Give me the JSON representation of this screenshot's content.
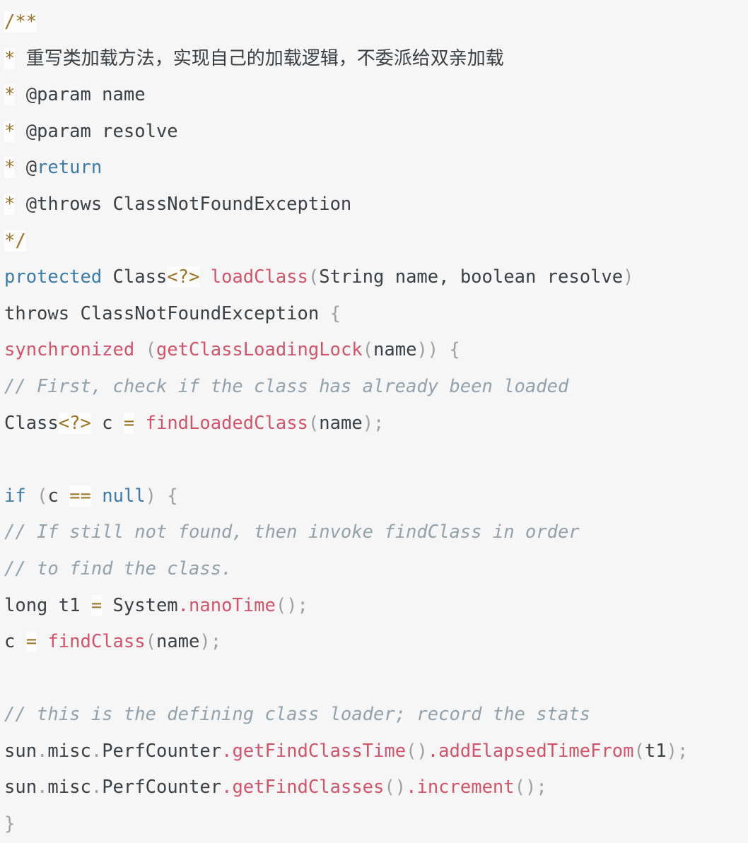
{
  "editor": {
    "language": "java",
    "background_color": "#f6f6f6",
    "token_colors": {
      "plain": "#3b4045",
      "keyword": "#3a7ca8",
      "function": "#d2546b",
      "operator": "#9b7526",
      "punctuation": "#9aa0a6",
      "comment": "#93a1ab"
    }
  },
  "code": {
    "lines": [
      {
        "n": 1,
        "tokens": [
          {
            "t": "op",
            "v": "/**"
          }
        ]
      },
      {
        "n": 2,
        "tokens": [
          {
            "t": "cjk-star",
            "v": "*"
          },
          {
            "t": "plain",
            "v": " "
          },
          {
            "t": "cjk",
            "v": "重写类加载方法，实现自己的加载逻辑，不委派给双亲加载"
          }
        ]
      },
      {
        "n": 3,
        "tokens": [
          {
            "t": "cjk-star",
            "v": "*"
          },
          {
            "t": "plain",
            "v": " @param name"
          }
        ]
      },
      {
        "n": 4,
        "tokens": [
          {
            "t": "cjk-star",
            "v": "*"
          },
          {
            "t": "plain",
            "v": " @param resolve"
          }
        ]
      },
      {
        "n": 5,
        "tokens": [
          {
            "t": "cjk-star",
            "v": "*"
          },
          {
            "t": "plain",
            "v": " @"
          },
          {
            "t": "keyword",
            "v": "return"
          }
        ]
      },
      {
        "n": 6,
        "tokens": [
          {
            "t": "cjk-star",
            "v": "*"
          },
          {
            "t": "plain",
            "v": " @throws ClassNotFoundException"
          }
        ]
      },
      {
        "n": 7,
        "tokens": [
          {
            "t": "op",
            "v": "*/"
          }
        ]
      },
      {
        "n": 8,
        "tokens": [
          {
            "t": "keyword",
            "v": "protected"
          },
          {
            "t": "plain",
            "v": " Class"
          },
          {
            "t": "op",
            "v": "<?>"
          },
          {
            "t": "plain",
            "v": " "
          },
          {
            "t": "func",
            "v": "loadClass"
          },
          {
            "t": "punct",
            "v": "("
          },
          {
            "t": "plain",
            "v": "String name, boolean resolve"
          },
          {
            "t": "punct",
            "v": ")"
          }
        ]
      },
      {
        "n": 9,
        "tokens": [
          {
            "t": "plain",
            "v": "throws ClassNotFoundException "
          },
          {
            "t": "punct",
            "v": "{"
          }
        ]
      },
      {
        "n": 10,
        "tokens": [
          {
            "t": "func",
            "v": "synchronized"
          },
          {
            "t": "plain",
            "v": " "
          },
          {
            "t": "punct",
            "v": "("
          },
          {
            "t": "func",
            "v": "getClassLoadingLock"
          },
          {
            "t": "punct",
            "v": "("
          },
          {
            "t": "plain",
            "v": "name"
          },
          {
            "t": "punct",
            "v": "))"
          },
          {
            "t": "plain",
            "v": " "
          },
          {
            "t": "punct",
            "v": "{"
          }
        ]
      },
      {
        "n": 11,
        "tokens": [
          {
            "t": "comment",
            "v": "// First, check if the class has already been loaded"
          }
        ]
      },
      {
        "n": 12,
        "tokens": [
          {
            "t": "plain",
            "v": "Class"
          },
          {
            "t": "op",
            "v": "<?>"
          },
          {
            "t": "plain",
            "v": " c "
          },
          {
            "t": "op",
            "v": "="
          },
          {
            "t": "plain",
            "v": " "
          },
          {
            "t": "func",
            "v": "findLoadedClass"
          },
          {
            "t": "punct",
            "v": "("
          },
          {
            "t": "plain",
            "v": "name"
          },
          {
            "t": "punct",
            "v": ");"
          }
        ]
      },
      {
        "n": 13,
        "tokens": []
      },
      {
        "n": 14,
        "tokens": [
          {
            "t": "keyword",
            "v": "if"
          },
          {
            "t": "plain",
            "v": " "
          },
          {
            "t": "punct",
            "v": "("
          },
          {
            "t": "plain",
            "v": "c "
          },
          {
            "t": "op",
            "v": "=="
          },
          {
            "t": "plain",
            "v": " "
          },
          {
            "t": "keyword",
            "v": "null"
          },
          {
            "t": "punct",
            "v": ")"
          },
          {
            "t": "plain",
            "v": " "
          },
          {
            "t": "punct",
            "v": "{"
          }
        ]
      },
      {
        "n": 15,
        "tokens": [
          {
            "t": "comment",
            "v": "// If still not found, then invoke findClass in order"
          }
        ]
      },
      {
        "n": 16,
        "tokens": [
          {
            "t": "comment",
            "v": "// to find the class."
          }
        ]
      },
      {
        "n": 17,
        "tokens": [
          {
            "t": "plain",
            "v": "long t1 "
          },
          {
            "t": "op",
            "v": "="
          },
          {
            "t": "plain",
            "v": " System"
          },
          {
            "t": "func",
            "v": ".nanoTime"
          },
          {
            "t": "punct",
            "v": "();"
          }
        ]
      },
      {
        "n": 18,
        "tokens": [
          {
            "t": "plain",
            "v": "c "
          },
          {
            "t": "op",
            "v": "="
          },
          {
            "t": "plain",
            "v": " "
          },
          {
            "t": "func",
            "v": "findClass"
          },
          {
            "t": "punct",
            "v": "("
          },
          {
            "t": "plain",
            "v": "name"
          },
          {
            "t": "punct",
            "v": ");"
          }
        ]
      },
      {
        "n": 19,
        "tokens": []
      },
      {
        "n": 20,
        "tokens": [
          {
            "t": "comment",
            "v": "// this is the defining class loader; record the stats"
          }
        ]
      },
      {
        "n": 21,
        "tokens": [
          {
            "t": "plain",
            "v": "sun"
          },
          {
            "t": "punct",
            "v": "."
          },
          {
            "t": "plain",
            "v": "misc"
          },
          {
            "t": "punct",
            "v": "."
          },
          {
            "t": "plain",
            "v": "PerfCounter"
          },
          {
            "t": "func",
            "v": ".getFindClassTime"
          },
          {
            "t": "punct",
            "v": "()"
          },
          {
            "t": "func",
            "v": ".addElapsedTimeFrom"
          },
          {
            "t": "punct",
            "v": "("
          },
          {
            "t": "plain",
            "v": "t1"
          },
          {
            "t": "punct",
            "v": ");"
          }
        ]
      },
      {
        "n": 22,
        "tokens": [
          {
            "t": "plain",
            "v": "sun"
          },
          {
            "t": "punct",
            "v": "."
          },
          {
            "t": "plain",
            "v": "misc"
          },
          {
            "t": "punct",
            "v": "."
          },
          {
            "t": "plain",
            "v": "PerfCounter"
          },
          {
            "t": "func",
            "v": ".getFindClasses"
          },
          {
            "t": "punct",
            "v": "()"
          },
          {
            "t": "func",
            "v": ".increment"
          },
          {
            "t": "punct",
            "v": "();"
          }
        ]
      },
      {
        "n": 23,
        "tokens": [
          {
            "t": "punct",
            "v": "}"
          }
        ]
      }
    ]
  }
}
